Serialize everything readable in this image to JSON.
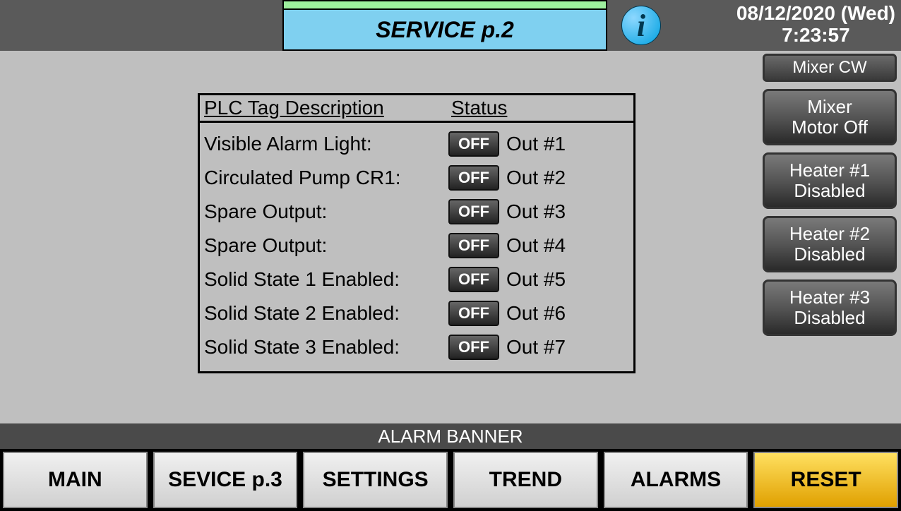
{
  "header": {
    "title": "SERVICE p.2",
    "info_icon": "i",
    "date": "08/12/2020 (Wed)",
    "time": "7:23:57"
  },
  "side_buttons": {
    "mixer_cw": "Mixer CW",
    "mixer_motor": "Mixer\nMotor Off",
    "heater1": "Heater #1\nDisabled",
    "heater2": "Heater #2\nDisabled",
    "heater3": "Heater #3\nDisabled"
  },
  "plc_table": {
    "header_desc": "PLC Tag Description",
    "header_status": "Status",
    "rows": [
      {
        "desc": "Visible Alarm Light:",
        "state": "OFF",
        "out": "Out #1"
      },
      {
        "desc": "Circulated Pump CR1:",
        "state": "OFF",
        "out": "Out #2"
      },
      {
        "desc": "Spare Output:",
        "state": "OFF",
        "out": "Out #3"
      },
      {
        "desc": "Spare Output:",
        "state": "OFF",
        "out": "Out #4"
      },
      {
        "desc": "Solid State 1 Enabled:",
        "state": "OFF",
        "out": "Out #5"
      },
      {
        "desc": "Solid State 2 Enabled:",
        "state": "OFF",
        "out": "Out #6"
      },
      {
        "desc": "Solid State 3 Enabled:",
        "state": "OFF",
        "out": "Out #7"
      }
    ]
  },
  "alarm_banner": "ALARM BANNER",
  "nav": {
    "main": "MAIN",
    "service": "SEVICE p.3",
    "settings": "SETTINGS",
    "trend": "TREND",
    "alarms": "ALARMS",
    "reset": "RESET"
  }
}
